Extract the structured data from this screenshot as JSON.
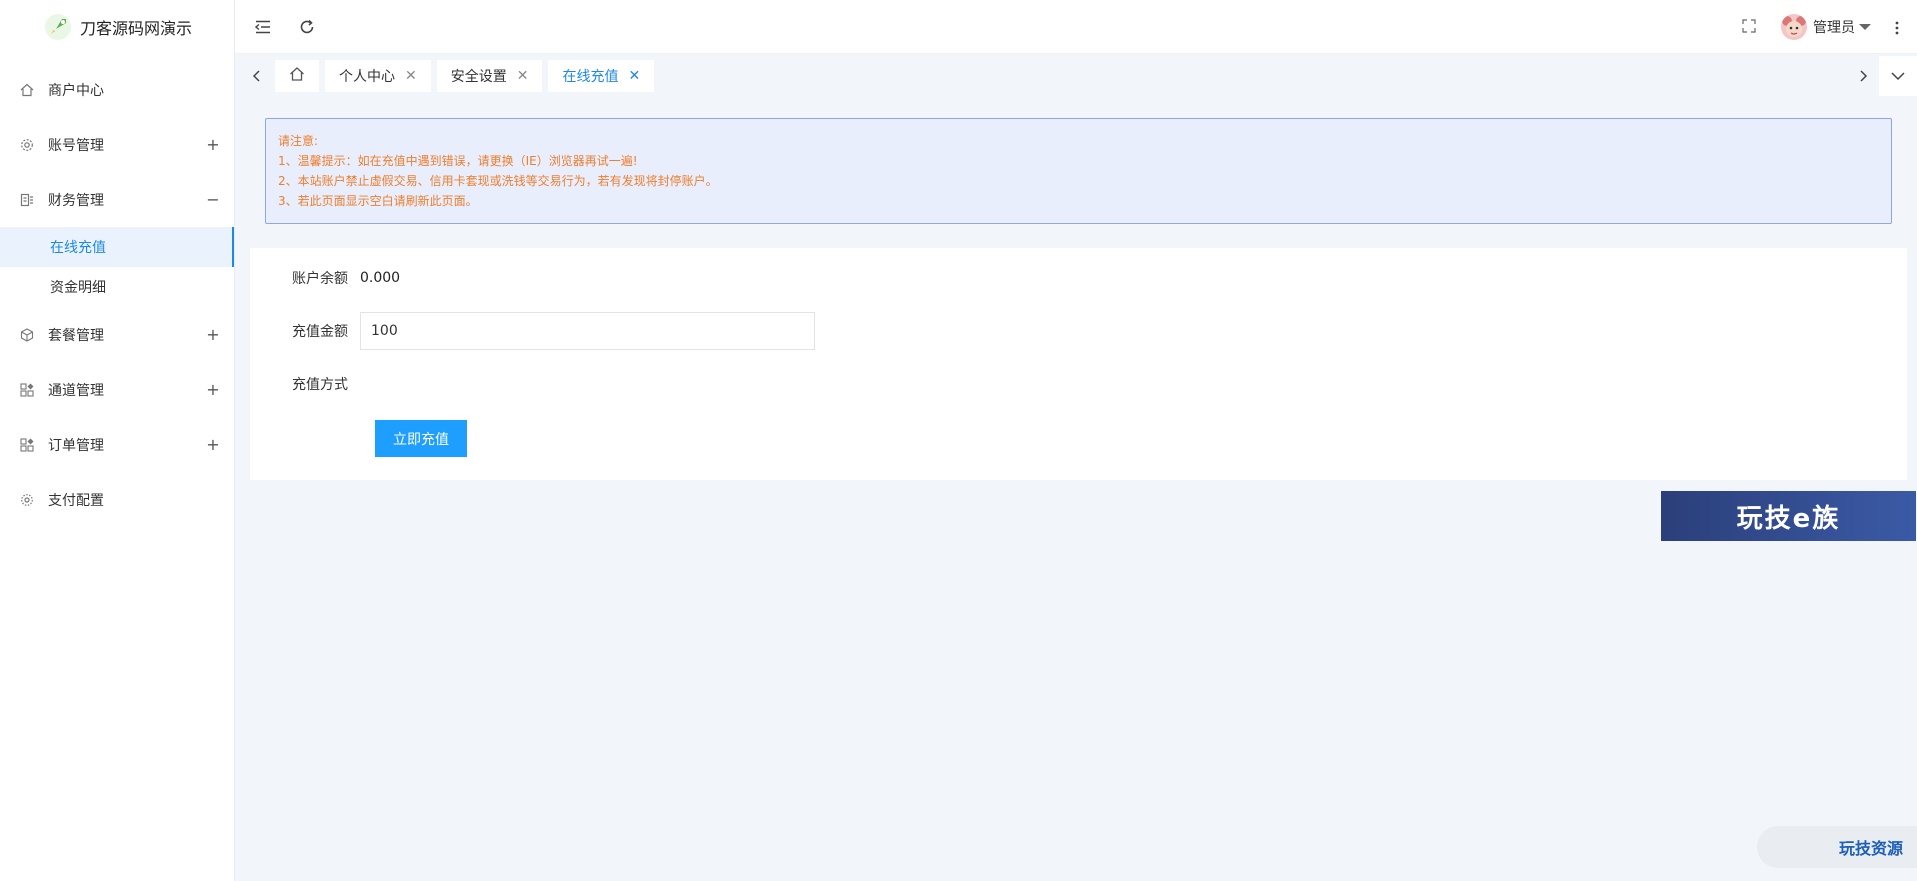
{
  "app": {
    "title": "刀客源码网演示"
  },
  "sidebar": {
    "items": [
      {
        "label": "商户中心",
        "icon": "home-icon",
        "toggle": ""
      },
      {
        "label": "账号管理",
        "icon": "gear-icon",
        "toggle": "+"
      },
      {
        "label": "财务管理",
        "icon": "finance-icon",
        "toggle": "−"
      },
      {
        "label": "套餐管理",
        "icon": "package-icon",
        "toggle": "+"
      },
      {
        "label": "通道管理",
        "icon": "grid-icon",
        "toggle": "+"
      },
      {
        "label": "订单管理",
        "icon": "grid-icon",
        "toggle": "+"
      },
      {
        "label": "支付配置",
        "icon": "cog-icon",
        "toggle": ""
      }
    ],
    "finance_sub": [
      {
        "label": "在线充值",
        "active": true
      },
      {
        "label": "资金明细",
        "active": false
      }
    ]
  },
  "header": {
    "user_name": "管理员"
  },
  "tabs": [
    {
      "label": "个人中心"
    },
    {
      "label": "安全设置"
    },
    {
      "label": "在线充值"
    }
  ],
  "notice": {
    "title": "请注意:",
    "lines": [
      "1、温馨提示：如在充值中遇到错误，请更换（IE）浏览器再试一遍!",
      "2、本站账户禁止虚假交易、信用卡套现或洗钱等交易行为，若有发现将封停账户。",
      "3、若此页面显示空白请刷新此页面。"
    ]
  },
  "form": {
    "balance_label": "账户余额",
    "balance_value": "0.000",
    "amount_label": "充值金额",
    "amount_value": "100",
    "method_label": "充值方式",
    "submit_label": "立即充值"
  },
  "watermarks": {
    "banner": "玩技e族",
    "pill": "玩技资源"
  },
  "colors": {
    "accent": "#1e88e5",
    "primary_button": "#1e9fff",
    "notice_text": "#f07e2e",
    "notice_bg": "#e8eefc"
  }
}
